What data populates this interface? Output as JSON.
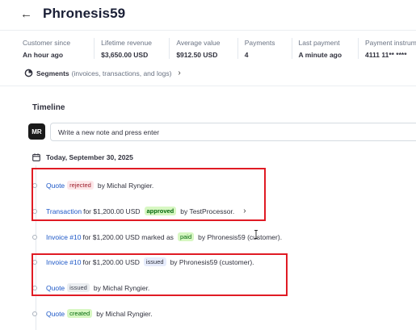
{
  "header": {
    "title": "Phronesis59"
  },
  "stats": [
    {
      "label": "Customer since",
      "value": "An hour ago"
    },
    {
      "label": "Lifetime revenue",
      "value": "$3,650.00 USD"
    },
    {
      "label": "Average value",
      "value": "$912.50 USD"
    },
    {
      "label": "Payments",
      "value": "4"
    },
    {
      "label": "Last payment",
      "value": "A minute ago"
    },
    {
      "label": "Payment instrum",
      "value": "4111 11** ****"
    }
  ],
  "segments": {
    "label": "Segments",
    "sub": "(invoices, transactions, and logs)"
  },
  "timeline": {
    "title": "Timeline",
    "avatar": "MR",
    "note_placeholder": "Write a new note and press enter",
    "date": "Today, September 30, 2025"
  },
  "events": [
    {
      "link": "Quote",
      "badge": "rejected",
      "text_after": "by Michal Ryngier."
    },
    {
      "link": "Transaction",
      "text_before": "for $1,200.00 USD",
      "badge": "approved",
      "text_after": "by TestProcessor."
    },
    {
      "link": "Invoice #10",
      "text_before": "for $1,200.00 USD marked as",
      "badge": "paid",
      "text_after": "by Phronesis59 (customer)."
    },
    {
      "link": "Invoice #10",
      "text_before": "for $1,200.00 USD",
      "badge": "issued",
      "text_after": "by Phronesis59 (customer)."
    },
    {
      "link": "Quote",
      "badge": "issued",
      "text_after": "by Michal Ryngier."
    },
    {
      "link": "Quote",
      "badge": "created",
      "text_after": "by Michal Ryngier."
    }
  ],
  "colors": {
    "link": "#1c57c7",
    "highlight": "#e01b24"
  },
  "icons": [
    "back-arrow-icon",
    "segments-icon",
    "chevron-right-icon",
    "calendar-icon"
  ]
}
